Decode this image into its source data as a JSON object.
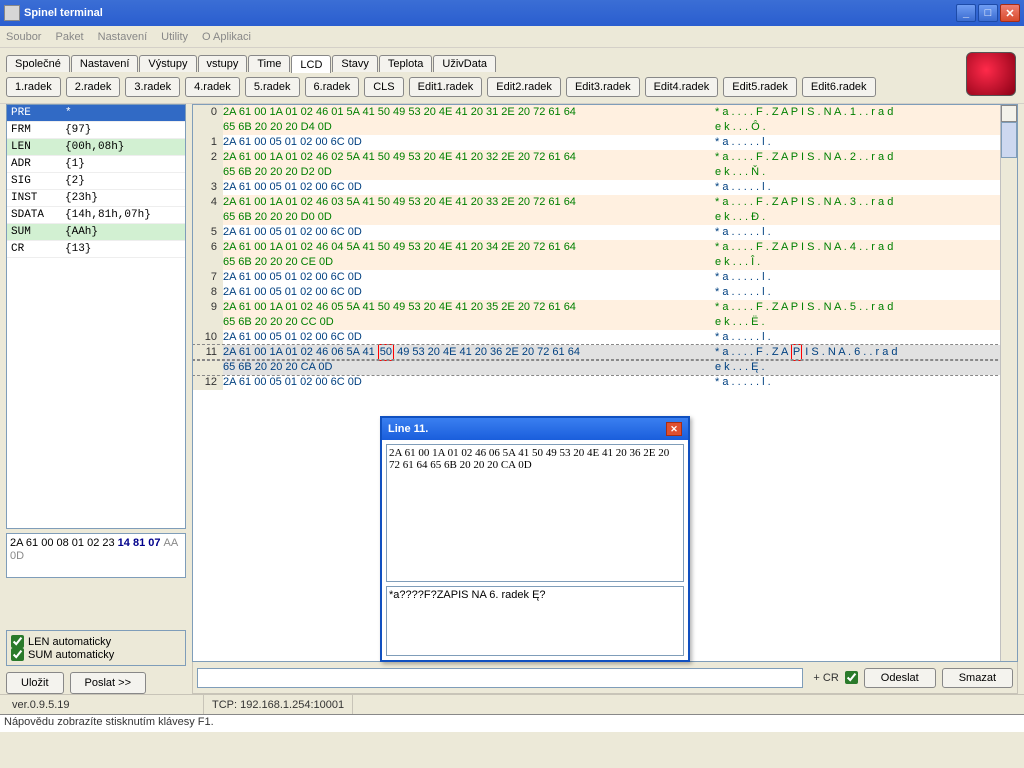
{
  "window": {
    "title": "Spinel terminal"
  },
  "menu": {
    "items": [
      "Soubor",
      "Paket",
      "Nastavení",
      "Utility"
    ],
    "right": "O Aplikaci"
  },
  "tabs": [
    "Společné",
    "Nastavení",
    "Výstupy",
    "vstupy",
    "Time",
    "LCD",
    "Stavy",
    "Teplota",
    "UživData"
  ],
  "active_tab": "LCD",
  "buttons_row": [
    "1.radek",
    "2.radek",
    "3.radek",
    "4.radek",
    "5.radek",
    "6.radek",
    "CLS",
    "Edit1.radek",
    "Edit2.radek",
    "Edit3.radek",
    "Edit4.radek",
    "Edit5.radek",
    "Edit6.radek"
  ],
  "left_table": [
    {
      "k": "PRE",
      "v": "*",
      "sel": true
    },
    {
      "k": "FRM",
      "v": "{97}"
    },
    {
      "k": "LEN",
      "v": "{00h,08h}",
      "hl": true
    },
    {
      "k": "ADR",
      "v": "{1}"
    },
    {
      "k": "SIG",
      "v": "{2}"
    },
    {
      "k": "INST",
      "v": "{23h}"
    },
    {
      "k": "SDATA",
      "v": "{14h,81h,07h}"
    },
    {
      "k": "SUM",
      "v": "{AAh}",
      "hl": true
    },
    {
      "k": "CR",
      "v": "{13}"
    }
  ],
  "left_hex": {
    "normal": "2A 61 00 08 01 02 23 ",
    "bold": "14 81 07 ",
    "gray": "AA 0D"
  },
  "checks": {
    "len": "LEN automaticky",
    "sum": "SUM automaticky"
  },
  "left_buttons": {
    "save": "Uložit",
    "send": "Poslat >>"
  },
  "right_buttons": {
    "cr": "+ CR",
    "send": "Odeslat",
    "clear": "Smazat"
  },
  "status": {
    "ver": "ver.0.9.5.19",
    "conn": "TCP: 192.168.1.254:10001"
  },
  "help": "Nápovědu zobrazíte stisknutím klávesy F1.",
  "popup": {
    "title": "Line 11.",
    "hex": "2A 61 00 1A 01 02 46 06 5A 41 50 49 53 20 4E 41 20 36 2E 20 72 61 64 65 6B 20 20 20 CA 0D",
    "ascii": "*a????F?ZAPIS NA 6. radek   Ę?"
  },
  "hex_lines": [
    {
      "n": "0",
      "c": "green",
      "hex": "2A 61 00 1A 01 02 46 01 5A 41 50 49 53 20 4E 41 20 31 2E 20 72 61 64",
      "asc": "* a . . . . F . Z A P I S . N A . 1 . . r a d",
      "alt": true
    },
    {
      "n": "",
      "c": "green",
      "hex": "65 6B 20 20 20 D4 0D",
      "asc": "e k . . . Ô .",
      "alt": true
    },
    {
      "n": "1",
      "c": "blue",
      "hex": "2A 61 00 05 01 02 00 6C 0D",
      "asc": "* a . . . . . l ."
    },
    {
      "n": "2",
      "c": "green",
      "hex": "2A 61 00 1A 01 02 46 02 5A 41 50 49 53 20 4E 41 20 32 2E 20 72 61 64",
      "asc": "* a . . . . F . Z A P I S . N A . 2 . . r a d",
      "alt": true
    },
    {
      "n": "",
      "c": "green",
      "hex": "65 6B 20 20 20 D2 0D",
      "asc": "e k . . . Ň .",
      "alt": true
    },
    {
      "n": "3",
      "c": "blue",
      "hex": "2A 61 00 05 01 02 00 6C 0D",
      "asc": "* a . . . . . l ."
    },
    {
      "n": "4",
      "c": "green",
      "hex": "2A 61 00 1A 01 02 46 03 5A 41 50 49 53 20 4E 41 20 33 2E 20 72 61 64",
      "asc": "* a . . . . F . Z A P I S . N A . 3 . . r a d",
      "alt": true
    },
    {
      "n": "",
      "c": "green",
      "hex": "65 6B 20 20 20 D0 0D",
      "asc": "e k . . . Đ .",
      "alt": true
    },
    {
      "n": "5",
      "c": "blue",
      "hex": "2A 61 00 05 01 02 00 6C 0D",
      "asc": "* a . . . . . l ."
    },
    {
      "n": "6",
      "c": "green",
      "hex": "2A 61 00 1A 01 02 46 04 5A 41 50 49 53 20 4E 41 20 34 2E 20 72 61 64",
      "asc": "* a . . . . F . Z A P I S . N A . 4 . . r a d",
      "alt": true
    },
    {
      "n": "",
      "c": "green",
      "hex": "65 6B 20 20 20 CE 0D",
      "asc": "e k . . . Î .",
      "alt": true
    },
    {
      "n": "7",
      "c": "blue",
      "hex": "2A 61 00 05 01 02 00 6C 0D",
      "asc": "* a . . . . . l ."
    },
    {
      "n": "8",
      "c": "blue",
      "hex": "2A 61 00 05 01 02 00 6C 0D",
      "asc": "* a . . . . . l ."
    },
    {
      "n": "9",
      "c": "green",
      "hex": "2A 61 00 1A 01 02 46 05 5A 41 50 49 53 20 4E 41 20 35 2E 20 72 61 64",
      "asc": "* a . . . . F . Z A P I S . N A . 5 . . r a d",
      "alt": true
    },
    {
      "n": "",
      "c": "green",
      "hex": "65 6B 20 20 20 CC 0D",
      "asc": "e k . . . Ë .",
      "alt": true
    },
    {
      "n": "10",
      "c": "blue",
      "hex": "2A 61 00 05 01 02 00 6C 0D",
      "asc": "* a . . . . . l ."
    },
    {
      "n": "11",
      "c": "cur",
      "hex_pre": "2A 61 00 1A 01 02 46 06 5A 41 ",
      "hex_box": "50",
      "hex_post": " 49 53 20 4E 41 20 36 2E 20 72 61 64",
      "asc_pre": "* a . . . . F . Z A ",
      "asc_box": "P",
      "asc_post": " I S . N A . 6 . . r a d",
      "cur": true
    },
    {
      "n": "",
      "c": "cur",
      "hex": "65 6B 20 20 20 CA 0D",
      "asc": "e k . . . Ę .",
      "cur": true
    },
    {
      "n": "12",
      "c": "blue",
      "hex": "2A 61 00 05 01 02 00 6C 0D",
      "asc": "* a . . . . . l ."
    }
  ]
}
